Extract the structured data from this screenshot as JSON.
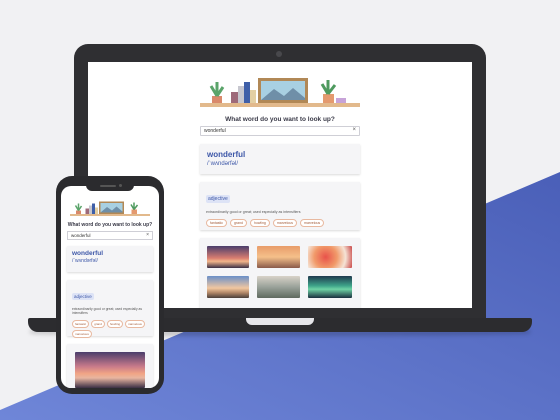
{
  "app": {
    "prompt": "What word do you want to look up?",
    "search_value": "wonderful",
    "clear_glyph": "×",
    "word": "wonderful",
    "phonetic": "/ˈwʌndərfəl/",
    "part_of_speech": "adjective",
    "definition": "extraordinarily good or great; used especially as intensifiers",
    "synonyms": [
      "fantastic",
      "grand",
      "howling",
      "marvelous",
      "marvelous"
    ],
    "phone_synonyms": [
      "fantastic",
      "grand",
      "howling",
      "marvelous",
      "marvelous"
    ]
  },
  "colors": {
    "accent": "#3d57a8",
    "background_blue": "#5a70c6",
    "chip_border": "#e8b9a0",
    "device": "#2f2f32"
  }
}
